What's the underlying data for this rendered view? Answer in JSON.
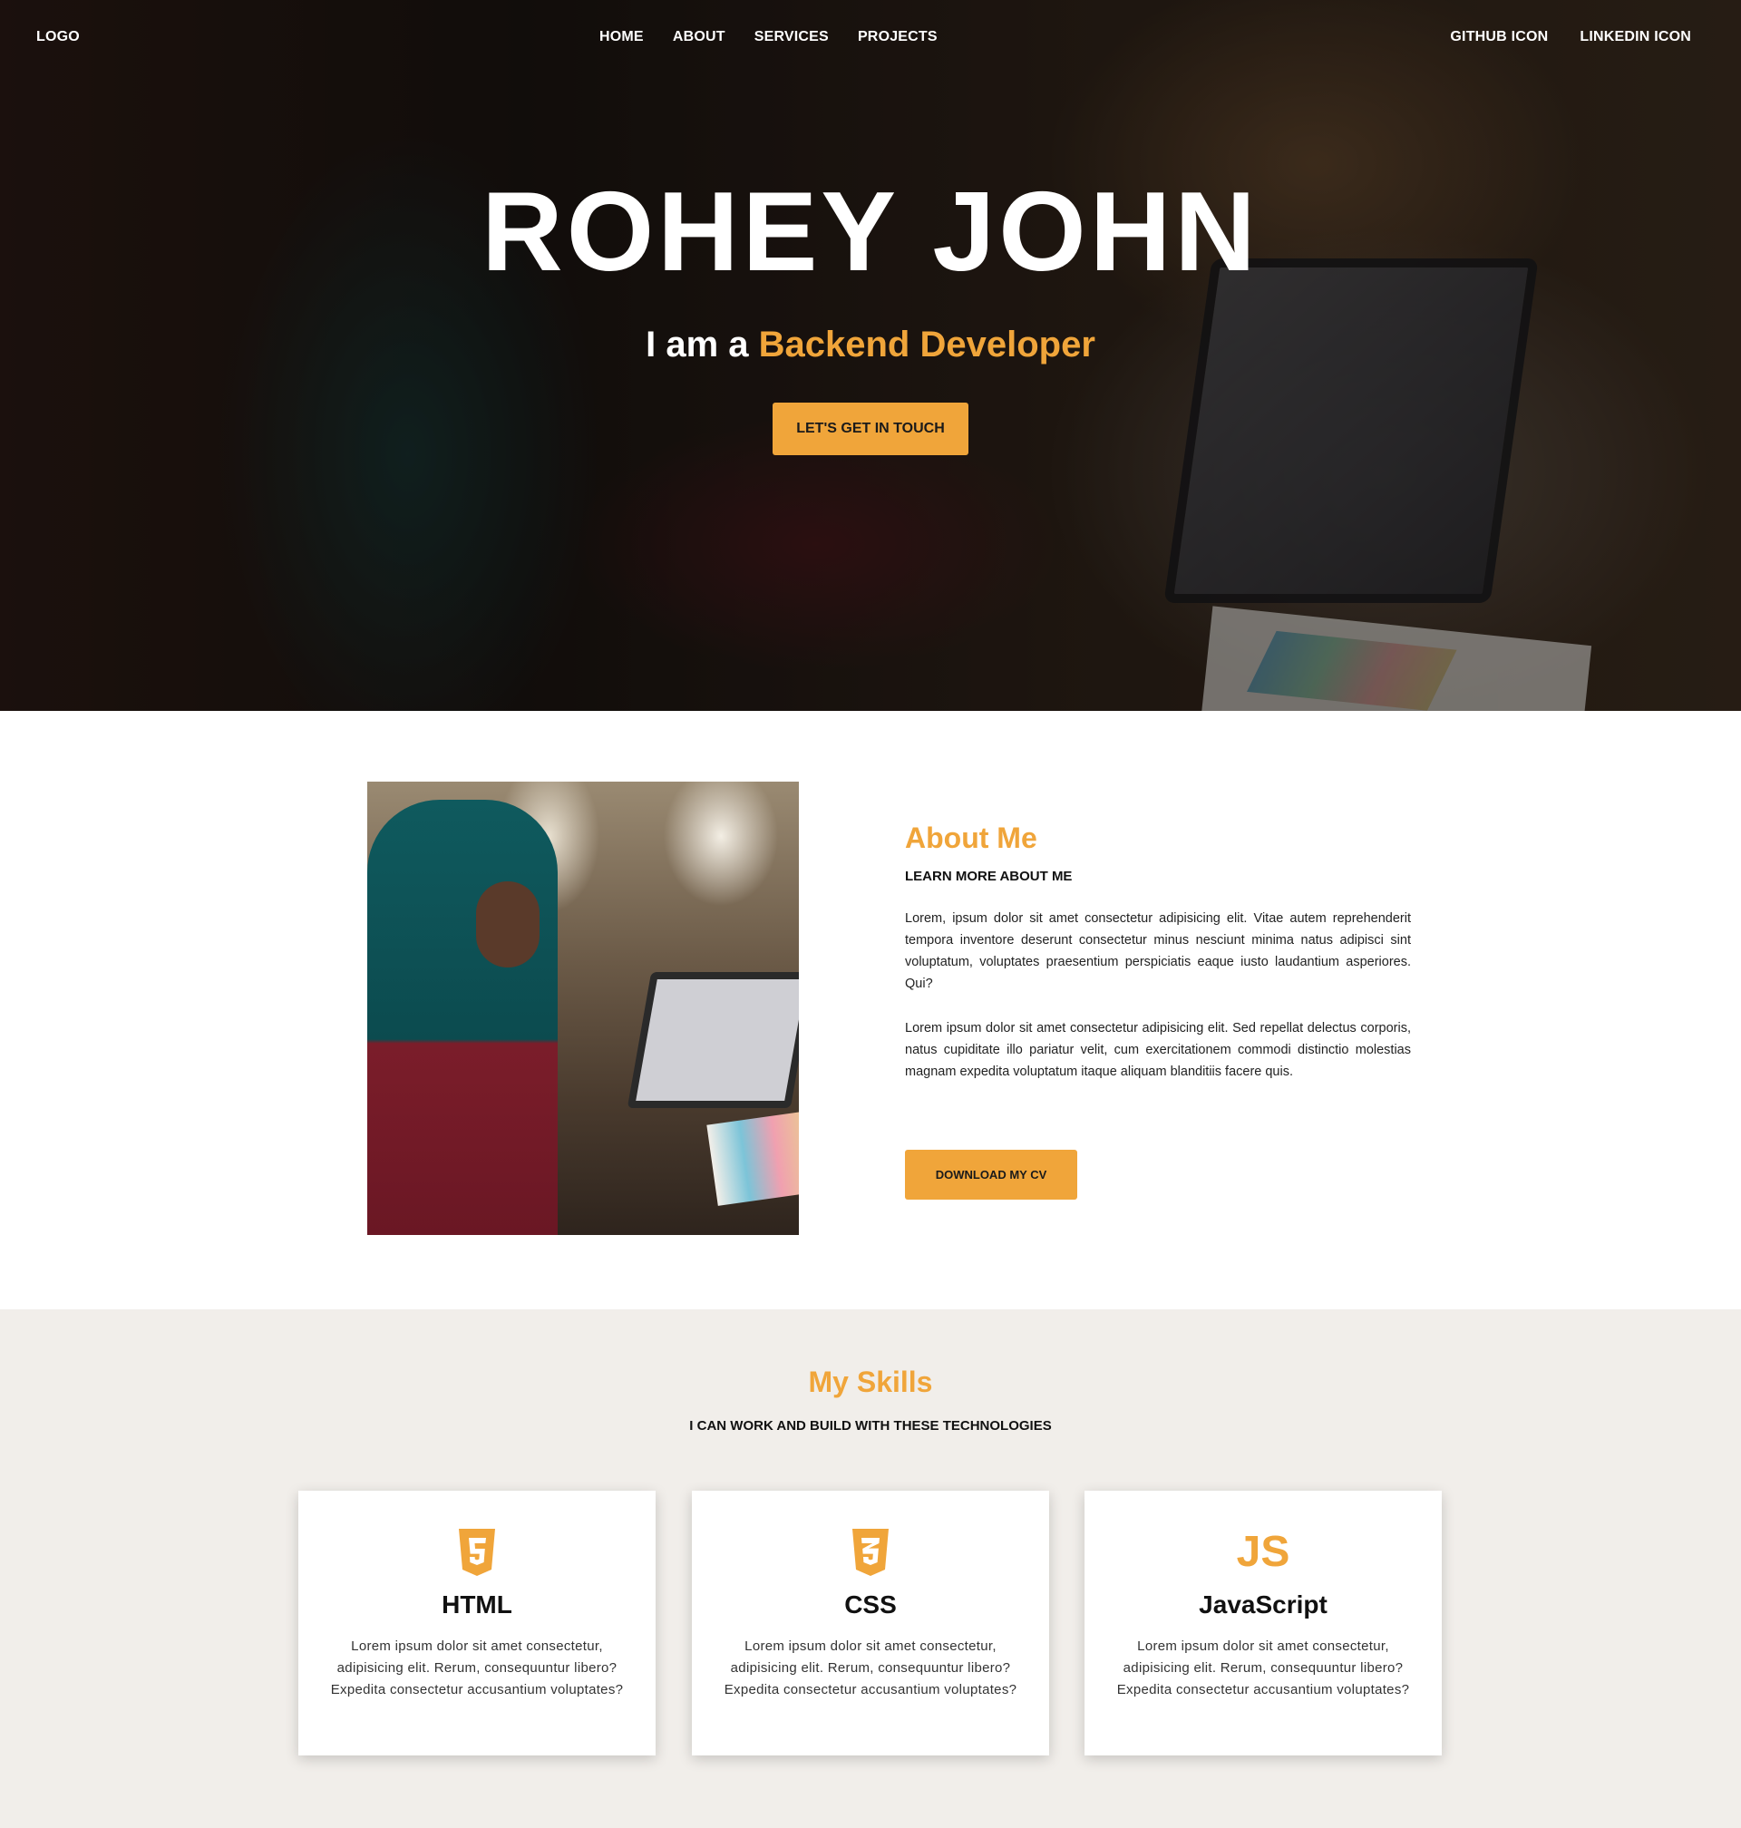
{
  "nav": {
    "logo": "LOGO",
    "links": [
      "HOME",
      "ABOUT",
      "SERVICES",
      "PROJECTS"
    ],
    "social": [
      "GITHUB ICON",
      "LINKEDIN ICON"
    ]
  },
  "hero": {
    "name": "ROHEY JOHN",
    "tag_prefix": "I am a ",
    "tag_role": "Backend Developer",
    "cta": "LET'S GET IN TOUCH"
  },
  "about": {
    "title": "About Me",
    "subtitle": "LEARN MORE ABOUT ME",
    "para1": "Lorem, ipsum dolor sit amet consectetur adipisicing elit. Vitae autem reprehenderit tempora inventore deserunt consectetur minus nesciunt minima natus adipisci sint voluptatum, voluptates praesentium perspiciatis eaque iusto laudantium asperiores. Qui?",
    "para2": "Lorem ipsum dolor sit amet consectetur adipisicing elit. Sed repellat delectus corporis, natus cupiditate illo pariatur velit, cum exercitationem commodi distinctio molestias magnam expedita voluptatum itaque aliquam blanditiis facere quis.",
    "cv_button": "DOWNLOAD MY CV"
  },
  "skills": {
    "title": "My Skills",
    "subtitle": "I CAN WORK AND BUILD WITH THESE TECHNOLOGIES",
    "cards": [
      {
        "icon": "html5-icon",
        "name": "HTML",
        "desc": "Lorem ipsum dolor sit amet consectetur, adipisicing elit. Rerum, consequuntur libero? Expedita consectetur accusantium voluptates?"
      },
      {
        "icon": "css3-icon",
        "name": "CSS",
        "desc": "Lorem ipsum dolor sit amet consectetur, adipisicing elit. Rerum, consequuntur libero? Expedita consectetur accusantium voluptates?"
      },
      {
        "icon": "js-icon",
        "icon_text": "JS",
        "name": "JavaScript",
        "desc": "Lorem ipsum dolor sit amet consectetur, adipisicing elit. Rerum, consequuntur libero? Expedita consectetur accusantium voluptates?"
      }
    ]
  },
  "colors": {
    "accent": "#f0a53a",
    "section_bg": "#f1eeea",
    "text_dark": "#111111"
  }
}
